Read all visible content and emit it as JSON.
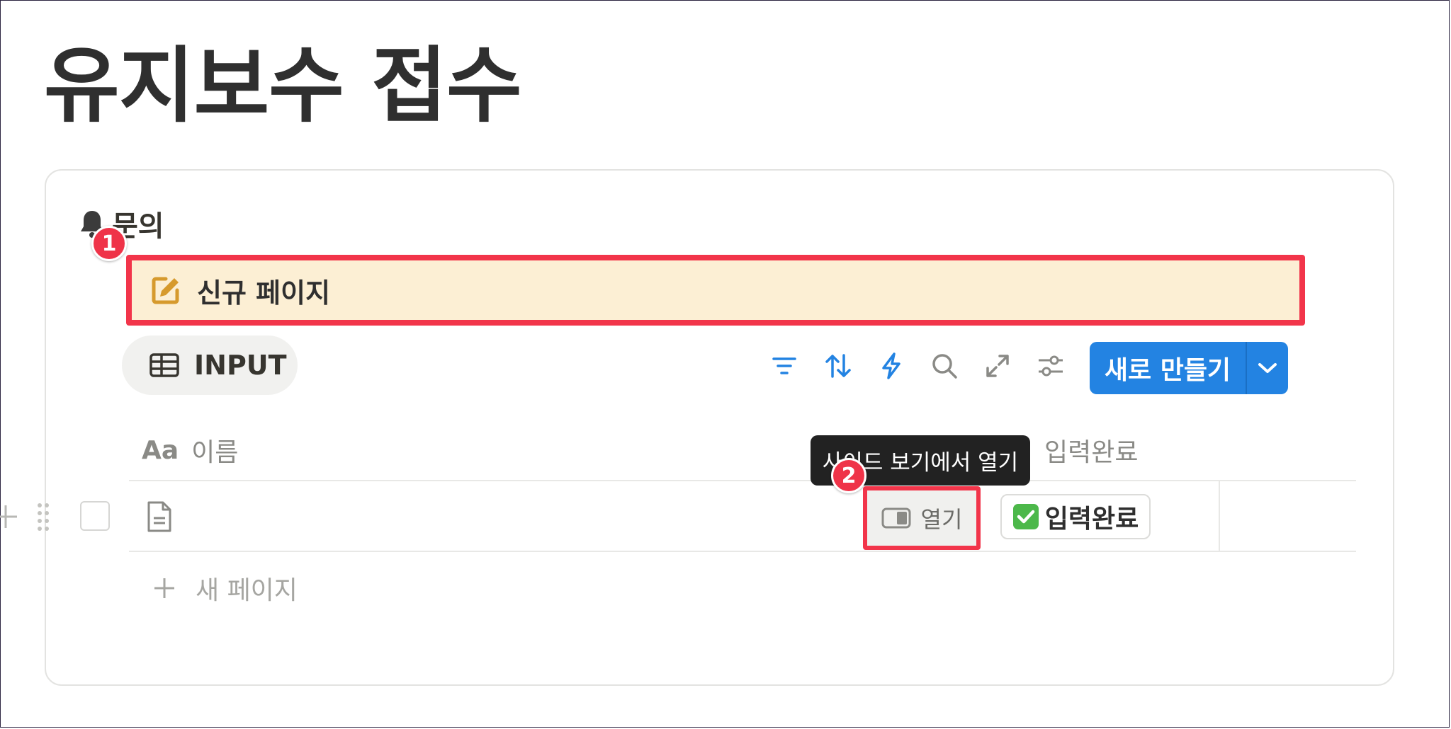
{
  "page": {
    "title": "유지보수 접수"
  },
  "database": {
    "name": "문의",
    "icon": "bell-icon",
    "template_button": {
      "label": "신규 페이지",
      "icon": "edit-icon"
    },
    "view_tab": {
      "label": "INPUT",
      "icon": "table-icon"
    },
    "toolbar": {
      "icons": [
        "filter-icon",
        "sort-icon",
        "automation-icon",
        "search-icon",
        "expand-icon",
        "settings-icon"
      ],
      "new_button_label": "새로 만들기"
    },
    "columns": [
      {
        "type_label": "Aa",
        "label": "이름"
      },
      {
        "label": "입력완료"
      }
    ],
    "rows": [
      {
        "name": "",
        "open_label": "열기",
        "status": "입력완료"
      }
    ],
    "tooltip": "사이드 보기에서 열기",
    "new_page_label": "새 페이지"
  },
  "annotations": {
    "badge_1": "1",
    "badge_2": "2"
  },
  "colors": {
    "accent": "#2383e2",
    "highlight_border": "#f2354a",
    "template_bg": "#fcefd4",
    "icon_blue": "#2383e2",
    "edit_icon": "#d69a2d"
  }
}
